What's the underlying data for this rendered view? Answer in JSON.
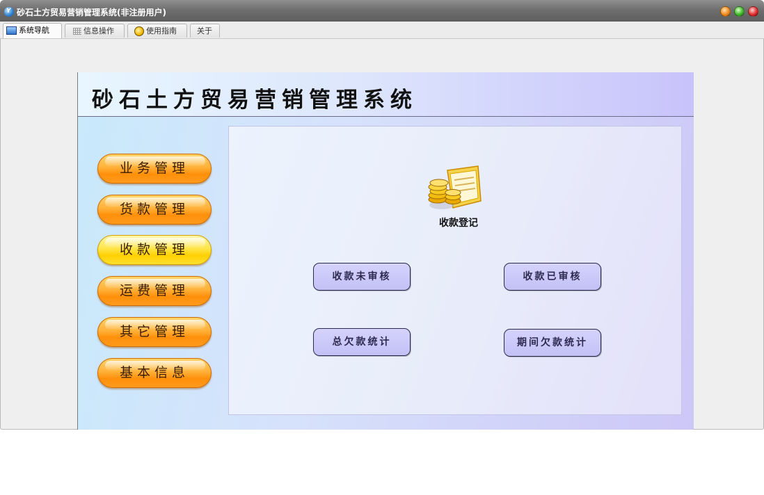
{
  "window": {
    "title": "砂石土方贸易营销管理系统(非注册用户)",
    "app_icon": "app-logo-icon",
    "controls": [
      "minimize-icon",
      "maximize-icon",
      "close-icon"
    ]
  },
  "tabs": [
    {
      "label": "系统导航",
      "icon": "monitor-icon",
      "active": true
    },
    {
      "label": "信息操作",
      "icon": "grid-icon",
      "active": false
    },
    {
      "label": "使用指南",
      "icon": "guide-icon",
      "active": false
    },
    {
      "label": "关于",
      "icon": "",
      "active": false
    }
  ],
  "banner": {
    "title": "砂石土方贸易营销管理系统"
  },
  "menu": {
    "items": [
      {
        "label": "业务管理",
        "selected": false
      },
      {
        "label": "货款管理",
        "selected": false
      },
      {
        "label": "收款管理",
        "selected": true
      },
      {
        "label": "运费管理",
        "selected": false
      },
      {
        "label": "其它管理",
        "selected": false
      },
      {
        "label": "基本信息",
        "selected": false
      }
    ]
  },
  "content": {
    "feature": {
      "label": "收款登记",
      "icon": "coins-ledger-icon"
    },
    "buttons": [
      {
        "label": "收款未审核"
      },
      {
        "label": "收款已审核"
      },
      {
        "label": "总欠款统计"
      },
      {
        "label": "期间欠款统计"
      }
    ]
  },
  "colors": {
    "menu_button": "#ff9a1e",
    "menu_button_selected": "#ffd000",
    "action_button": "#c8c5f8",
    "titlebar": "#6f6f6f"
  }
}
